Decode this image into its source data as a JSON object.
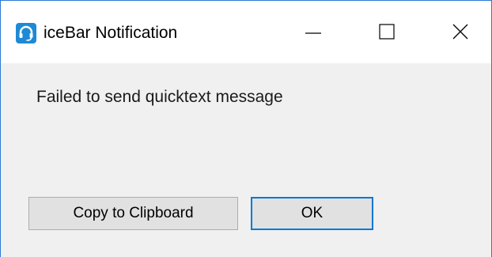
{
  "window": {
    "title": "iceBar Notification",
    "app_icon": "headset-icon",
    "controls": [
      "minimize-icon",
      "maximize-icon",
      "close-icon"
    ]
  },
  "dialog": {
    "message": "Failed to send quicktext message",
    "buttons": {
      "copy_label": "Copy to Clipboard",
      "ok_label": "OK"
    }
  },
  "colors": {
    "accent": "#0078d7",
    "window_border": "#2b79d6",
    "app_icon_bg": "#1e8ad6",
    "content_bg": "#f0f0f0",
    "button_bg": "#e1e1e1"
  }
}
